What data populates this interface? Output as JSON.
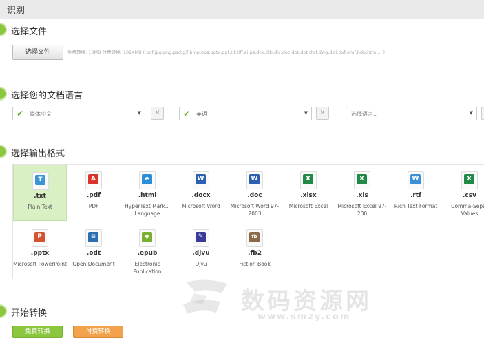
{
  "header": {
    "title": "识别"
  },
  "step1": {
    "label": "选择文件",
    "button": "选择文件",
    "note": "免费转换: 10MB 付费转换: 1024MB ( pdf,jpg,png,psd,gif,bmp,eps,pptx,ppt,tif,tiff,ai,ps,dcx,dib,djv,doc,dot,dot,dwf,dwg,dwl,dxf,emf,hdp,htm,... )"
  },
  "step2": {
    "label": "选择您的文档语言",
    "languages": [
      {
        "value": "简体中文",
        "checked": true
      },
      {
        "value": "英语",
        "checked": true
      },
      {
        "value": "选择语言..",
        "checked": false
      }
    ],
    "remove_label": "✕"
  },
  "step3": {
    "label": "选择输出格式",
    "formats": [
      {
        "ext": ".txt",
        "desc": "Plain Text",
        "icon": "txt-icon",
        "mark": "T",
        "color": "#3a96d4",
        "selected": true
      },
      {
        "ext": ".pdf",
        "desc": "PDF",
        "icon": "pdf-icon",
        "mark": "A",
        "color": "#d9342b",
        "selected": false
      },
      {
        "ext": ".html",
        "desc": "HyperText Mark... Language",
        "icon": "html-icon",
        "mark": "e",
        "color": "#2a8fd6",
        "selected": false
      },
      {
        "ext": ".docx",
        "desc": "Microsoft Word",
        "icon": "word-icon",
        "mark": "W",
        "color": "#2b5fb0",
        "selected": false
      },
      {
        "ext": ".doc",
        "desc": "Microsoft Word 97-2003",
        "icon": "word-icon",
        "mark": "W",
        "color": "#2b5fb0",
        "selected": false
      },
      {
        "ext": ".xlsx",
        "desc": "Microsoft Excel",
        "icon": "excel-icon",
        "mark": "X",
        "color": "#1f8a45",
        "selected": false
      },
      {
        "ext": ".xls",
        "desc": "Microsoft Excel 97-200",
        "icon": "excel-icon",
        "mark": "X",
        "color": "#1f8a45",
        "selected": false
      },
      {
        "ext": ".rtf",
        "desc": "Rich Text Format",
        "icon": "rtf-icon",
        "mark": "W",
        "color": "#3a8fd6",
        "selected": false
      },
      {
        "ext": ".csv",
        "desc": "Comma-Separ Values",
        "icon": "csv-icon",
        "mark": "X",
        "color": "#1f8a45",
        "selected": false
      },
      {
        "ext": ".pptx",
        "desc": "Microsoft PowerPoint",
        "icon": "powerpoint-icon",
        "mark": "P",
        "color": "#d35230",
        "selected": false
      },
      {
        "ext": ".odt",
        "desc": "Open Document",
        "icon": "odt-icon",
        "mark": "≡",
        "color": "#2a6db0",
        "selected": false
      },
      {
        "ext": ".epub",
        "desc": "Electronic Publication",
        "icon": "epub-icon",
        "mark": "◆",
        "color": "#7ab030",
        "selected": false
      },
      {
        "ext": ".djvu",
        "desc": "Djvu",
        "icon": "djvu-icon",
        "mark": "✎",
        "color": "#3a3a9a",
        "selected": false
      },
      {
        "ext": ".fb2",
        "desc": "Fiction Book",
        "icon": "fb2-icon",
        "mark": "fb",
        "color": "#8a6a4a",
        "selected": false
      }
    ]
  },
  "step4": {
    "label": "开始转换",
    "free_button": "免费转换",
    "paid_button": "付费转换"
  },
  "watermark": {
    "text": "数码资源网",
    "url": "www.smzy.com"
  },
  "colors": {
    "accent": "#8cc63f",
    "selected_bg": "#d9efc4",
    "paid": "#f2a24a"
  }
}
